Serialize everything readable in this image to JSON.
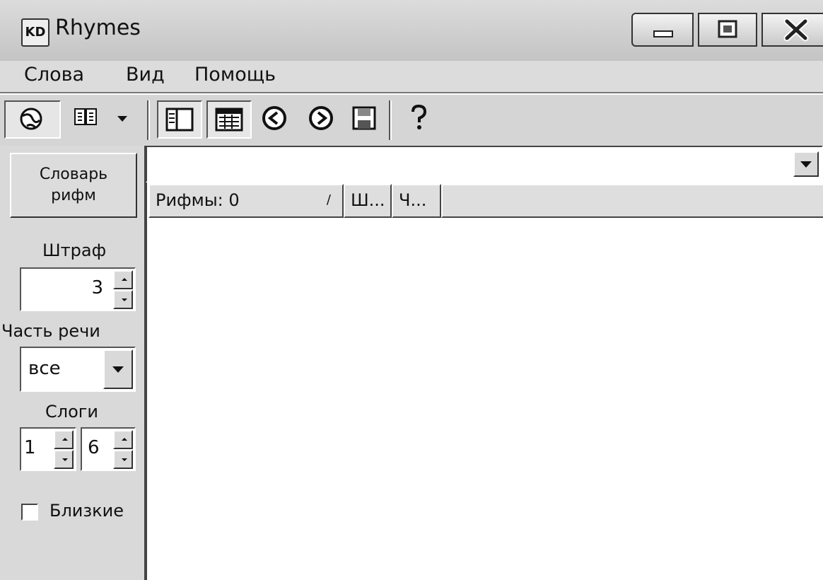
{
  "window": {
    "title": "Rhymes",
    "app_icon_label": "KD"
  },
  "menu": {
    "items": [
      "Слова",
      "Вид",
      "Помощь"
    ]
  },
  "toolbar": {
    "buttons": [
      "earth-icon",
      "book-dropdown-icon",
      "panel-icon",
      "table-icon",
      "back-icon",
      "forward-icon",
      "save-icon",
      "help-icon"
    ]
  },
  "left_panel": {
    "dictionary_button_line1": "Словарь",
    "dictionary_button_line2": "рифм",
    "penalty_label": "Штраф",
    "penalty_value": "3",
    "part_of_speech_label": "Часть речи",
    "part_of_speech_value": "все",
    "syllables_label": "Слоги",
    "syllables_min": "1",
    "syllables_max": "6",
    "close_label": "Близкие",
    "close_checked": false
  },
  "search": {
    "value": ""
  },
  "list": {
    "columns": [
      "Рифмы: 0",
      "Ш...",
      "Ч..."
    ],
    "sort_mark": "/",
    "rows": []
  }
}
